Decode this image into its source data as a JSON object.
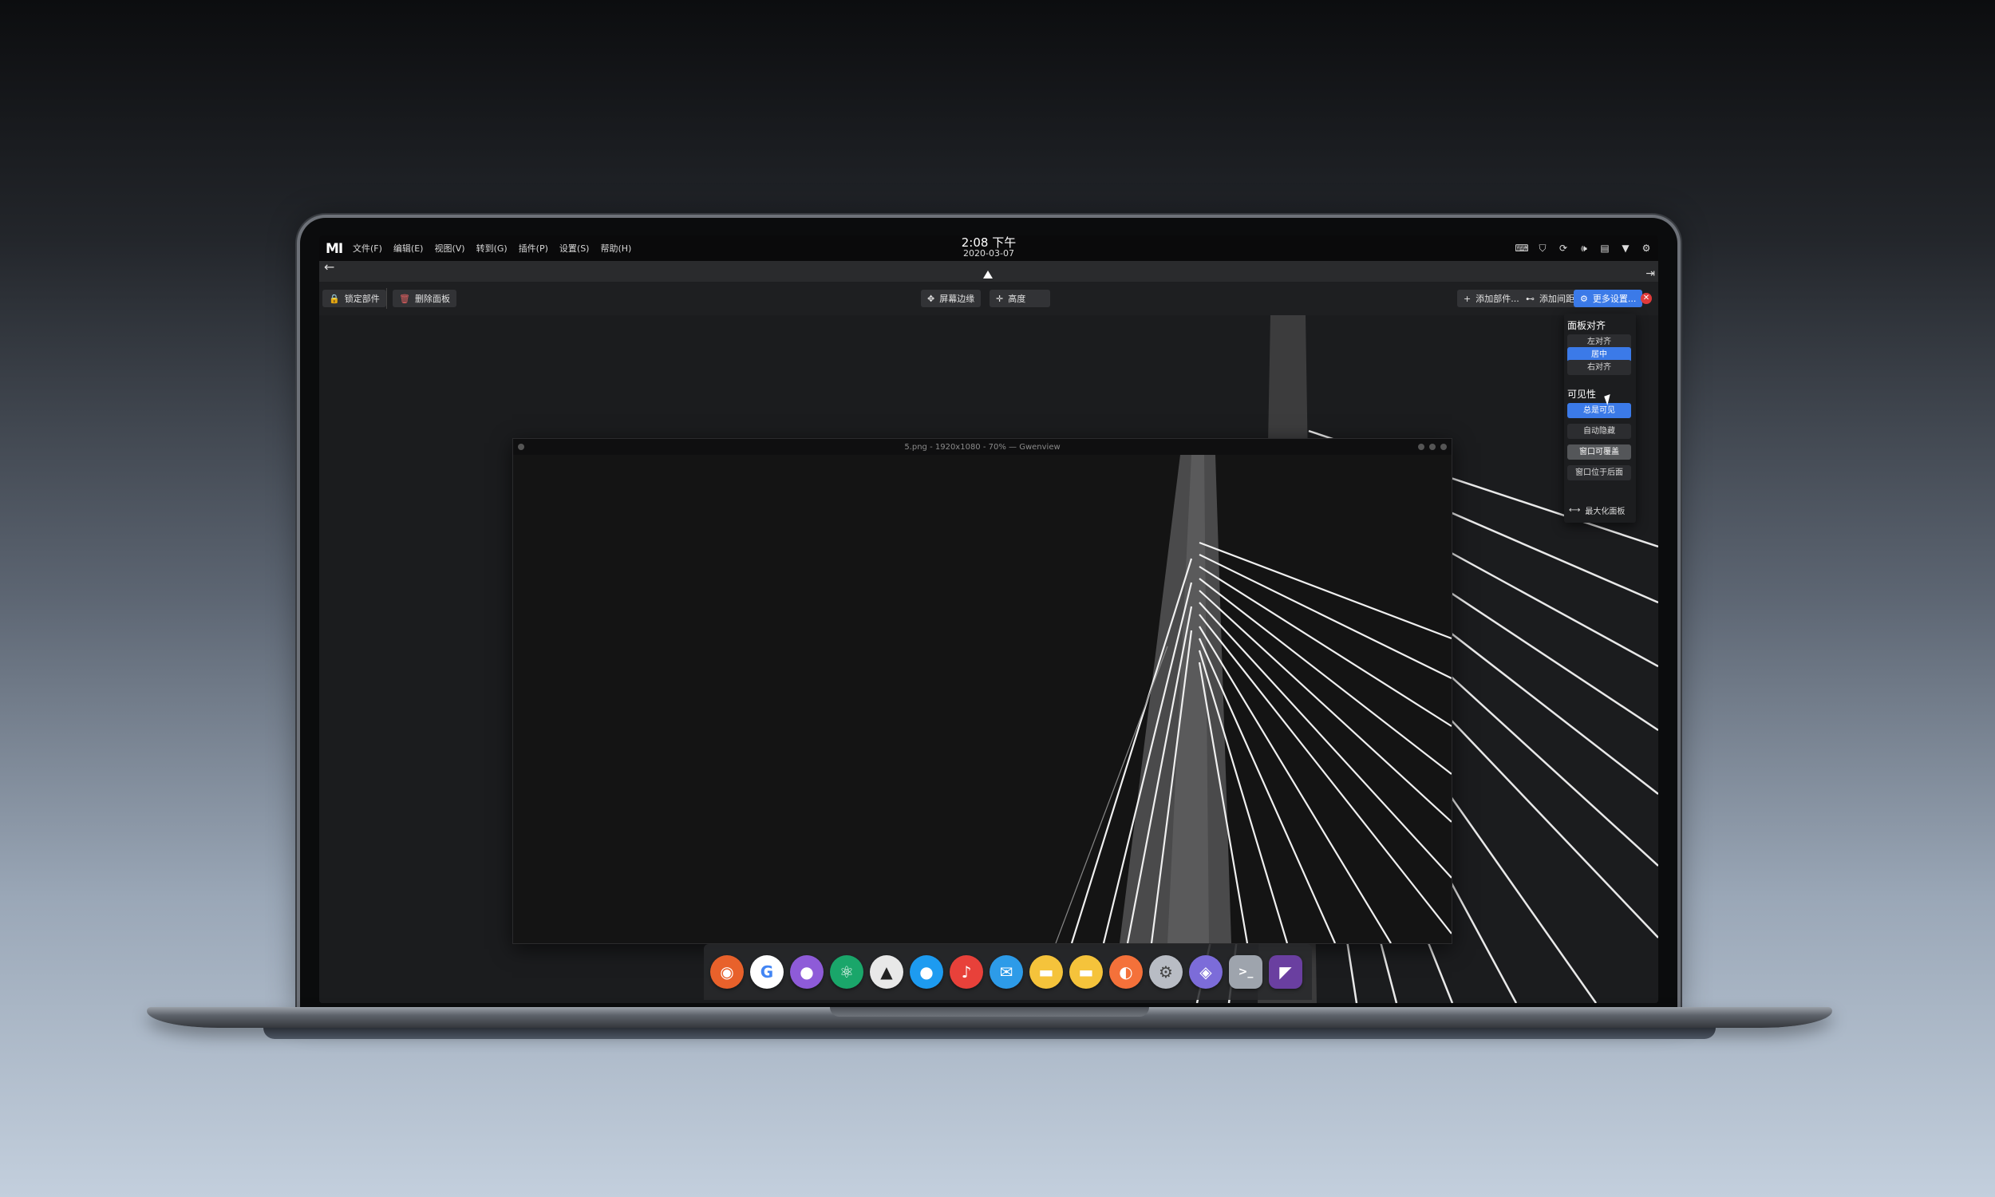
{
  "topbar": {
    "logo": "MI",
    "menus": [
      "文件(F)",
      "编辑(E)",
      "视图(V)",
      "转到(G)",
      "插件(P)",
      "设置(S)",
      "帮助(H)"
    ],
    "time": "2:08 下午",
    "date": "2020-03-07",
    "tray_icons": [
      "keyboard-icon",
      "shield-icon",
      "sync-icon",
      "volume-icon",
      "clipboard-icon",
      "dropdown-icon",
      "settings-icon"
    ]
  },
  "toolbar": {
    "lock_label": "锁定部件",
    "delete_label": "删除面板",
    "screen_edge_label": "屏幕边缘",
    "height_label": "高度",
    "add_widget_label": "添加部件...",
    "add_spacer_label": "添加间距",
    "more_settings_label": "更多设置..."
  },
  "gwenview": {
    "title": "5.png - 1920x1080 - 70% — Gwenview"
  },
  "panel_settings": {
    "alignment_header": "面板对齐",
    "alignment_options": [
      "左对齐",
      "居中",
      "右对齐"
    ],
    "alignment_selected": "居中",
    "visibility_header": "可见性",
    "visibility_options": [
      "总是可见",
      "自动隐藏",
      "窗口可覆盖",
      "窗口位于后面"
    ],
    "visibility_selected": "总是可见",
    "visibility_hovered": "窗口可覆盖",
    "maximize_label": "最大化面板"
  },
  "dock": {
    "apps": [
      {
        "name": "firefox-icon",
        "glyph": "◉",
        "color": "#e8612b"
      },
      {
        "name": "google-chrome-icon",
        "glyph": "G",
        "color": "#ffffff",
        "text": "#4285f4"
      },
      {
        "name": "github-icon",
        "glyph": "●",
        "color": "#8e5bd8"
      },
      {
        "name": "atom-icon",
        "glyph": "⚛",
        "color": "#1aa66a"
      },
      {
        "name": "inkscape-icon",
        "glyph": "▲",
        "color": "#e8e8e8",
        "text": "#222"
      },
      {
        "name": "qq-icon",
        "glyph": "●",
        "color": "#1d9bf0"
      },
      {
        "name": "music-icon",
        "glyph": "♪",
        "color": "#e8413a"
      },
      {
        "name": "mail-icon",
        "glyph": "✉",
        "color": "#2d9be8"
      },
      {
        "name": "folder-icon",
        "glyph": "▬",
        "color": "#f5c33b"
      },
      {
        "name": "notes-icon",
        "glyph": "▬",
        "color": "#f5c33b"
      },
      {
        "name": "store-icon",
        "glyph": "◐",
        "color": "#f4713a"
      },
      {
        "name": "system-settings-icon",
        "glyph": "⚙",
        "color": "#b8bcc4",
        "text": "#444"
      },
      {
        "name": "browser-icon",
        "glyph": "◈",
        "color": "#7c6cd9"
      },
      {
        "name": "terminal-icon",
        "glyph": ">_",
        "color": "#9ea4ad",
        "square": true
      },
      {
        "name": "visual-studio-icon",
        "glyph": "◤",
        "color": "#6a3fa0",
        "square": true
      }
    ]
  }
}
